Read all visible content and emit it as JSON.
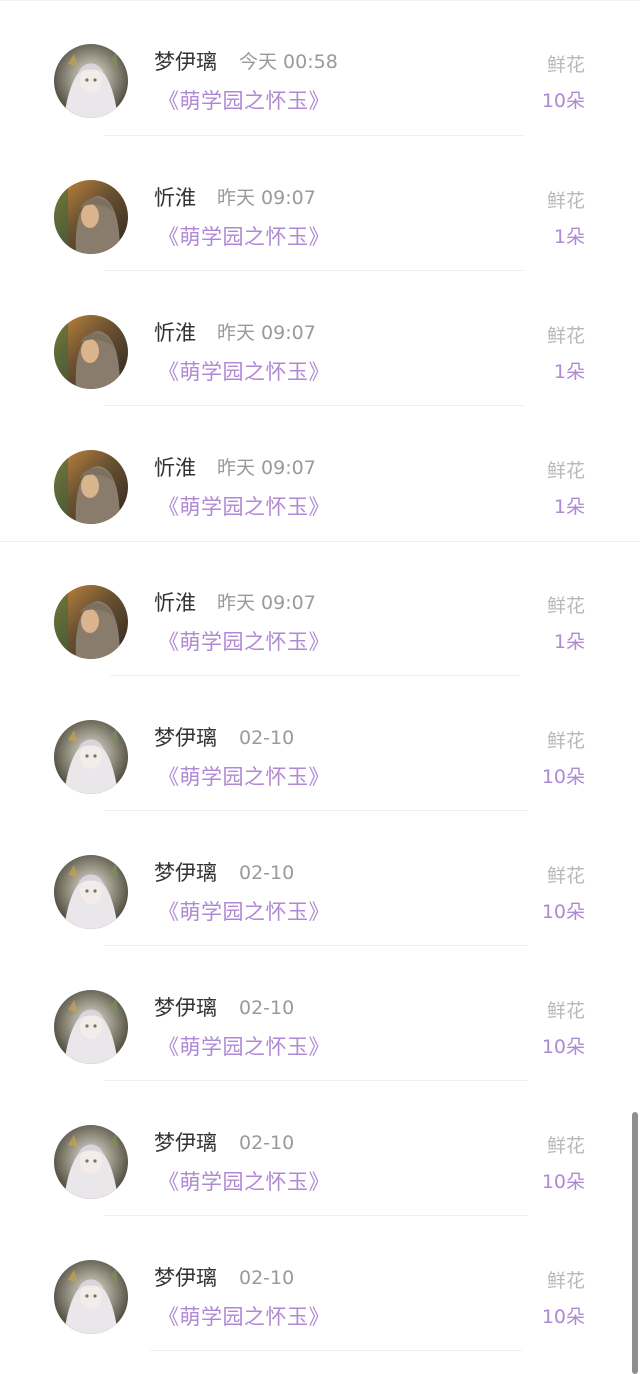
{
  "records": [
    {
      "user": "梦伊璃",
      "time": "今天 00:58",
      "book": "《萌学园之怀玉》",
      "gift": "鲜花",
      "count": "10朵",
      "avatar_icon": "anime-girl-avatar-icon"
    },
    {
      "user": "忻淮",
      "time": "昨天 09:07",
      "book": "《萌学园之怀玉》",
      "gift": "鲜花",
      "count": "1朵",
      "avatar_icon": "girl-photo-avatar-icon"
    },
    {
      "user": "忻淮",
      "time": "昨天 09:07",
      "book": "《萌学园之怀玉》",
      "gift": "鲜花",
      "count": "1朵",
      "avatar_icon": "girl-photo-avatar-icon"
    },
    {
      "user": "忻淮",
      "time": "昨天 09:07",
      "book": "《萌学园之怀玉》",
      "gift": "鲜花",
      "count": "1朵",
      "avatar_icon": "girl-photo-avatar-icon"
    },
    {
      "user": "忻淮",
      "time": "昨天 09:07",
      "book": "《萌学园之怀玉》",
      "gift": "鲜花",
      "count": "1朵",
      "avatar_icon": "girl-photo-avatar-icon"
    },
    {
      "user": "梦伊璃",
      "time": "02-10",
      "book": "《萌学园之怀玉》",
      "gift": "鲜花",
      "count": "10朵",
      "avatar_icon": "anime-girl-avatar-icon"
    },
    {
      "user": "梦伊璃",
      "time": "02-10",
      "book": "《萌学园之怀玉》",
      "gift": "鲜花",
      "count": "10朵",
      "avatar_icon": "anime-girl-avatar-icon"
    },
    {
      "user": "梦伊璃",
      "time": "02-10",
      "book": "《萌学园之怀玉》",
      "gift": "鲜花",
      "count": "10朵",
      "avatar_icon": "anime-girl-avatar-icon"
    },
    {
      "user": "梦伊璃",
      "time": "02-10",
      "book": "《萌学园之怀玉》",
      "gift": "鲜花",
      "count": "10朵",
      "avatar_icon": "anime-girl-avatar-icon"
    },
    {
      "user": "梦伊璃",
      "time": "02-10",
      "book": "《萌学园之怀玉》",
      "gift": "鲜花",
      "count": "10朵",
      "avatar_icon": "anime-girl-avatar-icon"
    }
  ],
  "colors": {
    "accent": "#b089d4",
    "name_text": "#333333",
    "meta_text": "#9a9a9a",
    "gift_text": "#b8b8b8"
  }
}
